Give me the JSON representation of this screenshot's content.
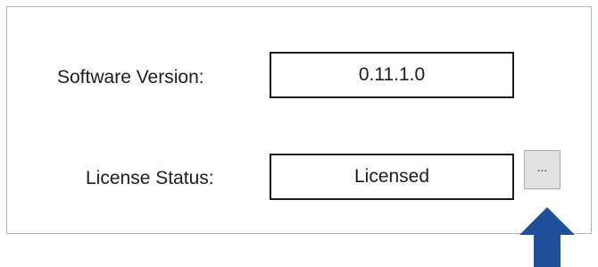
{
  "settings": {
    "software_version": {
      "label": "Software Version:",
      "value": "0.11.1.0"
    },
    "license_status": {
      "label": "License Status:",
      "value": "Licensed",
      "browse_button_label": "..."
    }
  },
  "annotation": {
    "icon": "up-arrow-icon",
    "color": "#1f4f9a"
  },
  "colors": {
    "panel_border": "#a7b8cc",
    "button_background": "#e1e1e1"
  }
}
